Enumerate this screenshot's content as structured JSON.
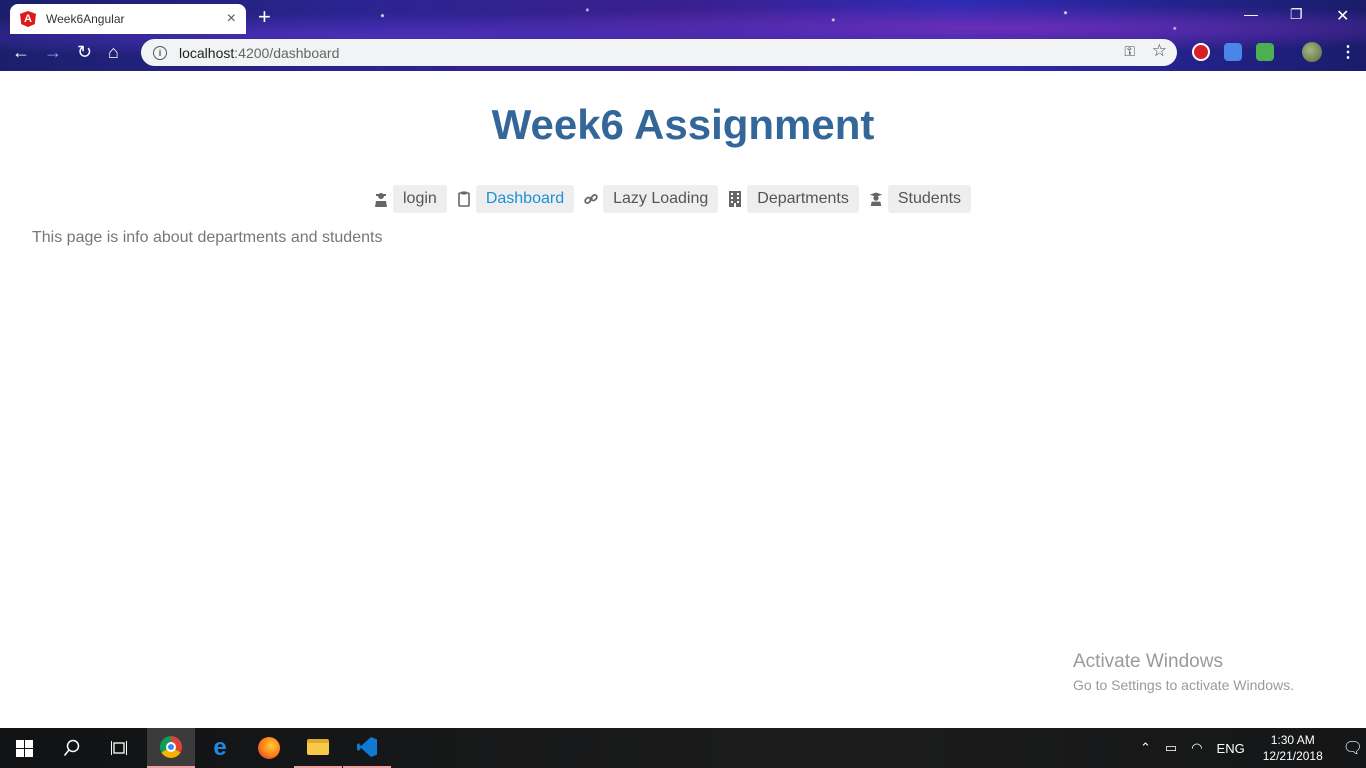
{
  "browser": {
    "tab_title": "Week6Angular",
    "tab_favicon": "A",
    "url_host": "localhost",
    "url_path": ":4200/dashboard"
  },
  "page": {
    "title": "Week6 Assignment",
    "nav": [
      {
        "label": "login",
        "icon": "user-secret-icon",
        "active": false
      },
      {
        "label": "Dashboard",
        "icon": "clipboard-icon",
        "active": true
      },
      {
        "label": "Lazy Loading",
        "icon": "link-icon",
        "active": false
      },
      {
        "label": "Departments",
        "icon": "building-icon",
        "active": false
      },
      {
        "label": "Students",
        "icon": "graduate-icon",
        "active": false
      }
    ],
    "info_text": "This page is info about departments and students"
  },
  "watermark": {
    "title": "Activate Windows",
    "subtitle": "Go to Settings to activate Windows."
  },
  "taskbar": {
    "language": "ENG",
    "time": "1:30 AM",
    "date": "12/21/2018"
  },
  "colors": {
    "title": "#336699",
    "active_link": "#1e90d6",
    "nav_bg": "#eeeeee"
  }
}
